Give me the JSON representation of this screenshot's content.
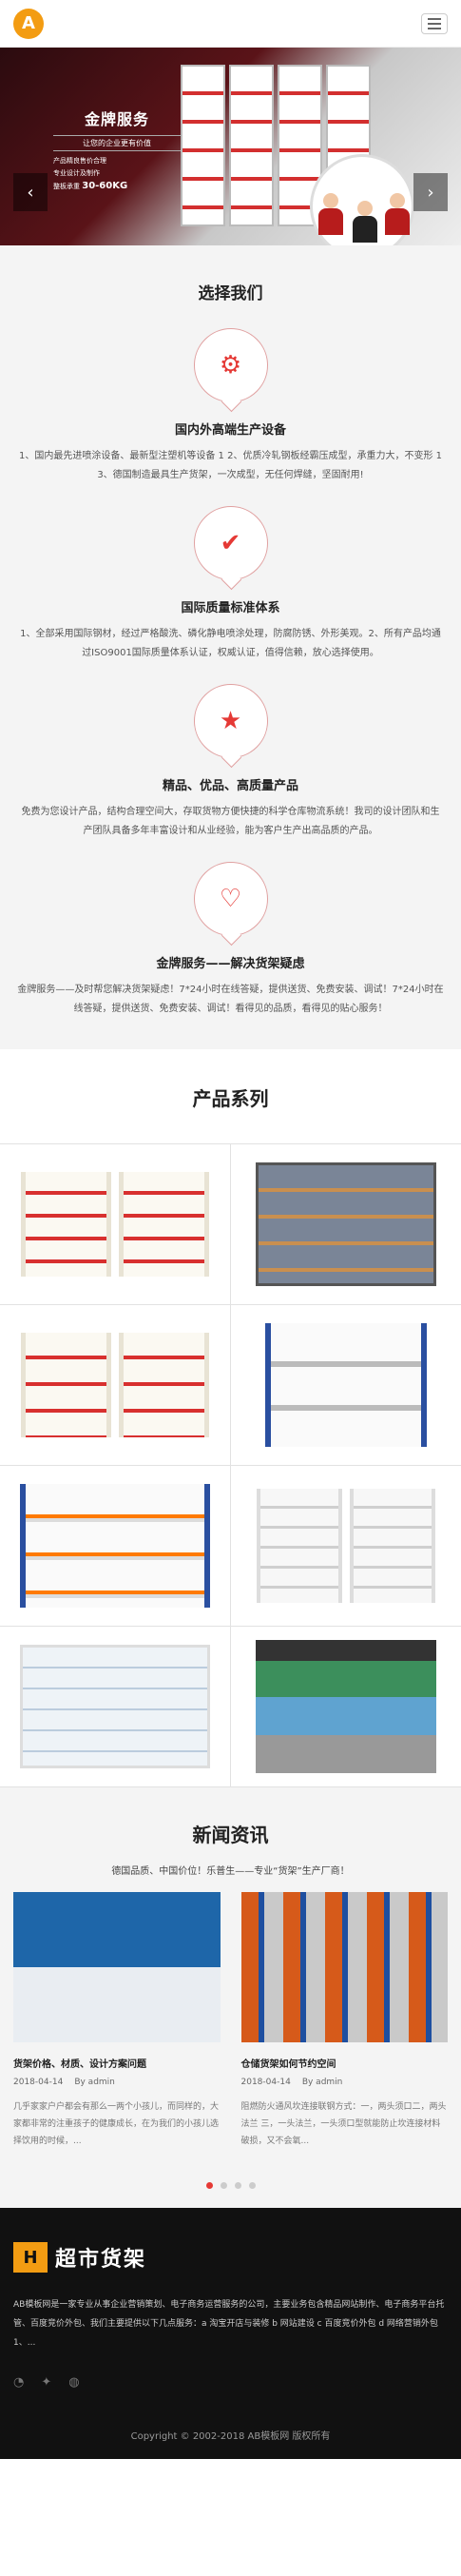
{
  "header": {
    "logo_letter": "A"
  },
  "banner": {
    "title": "金牌服务",
    "subtitle": "让您的企业更有价值",
    "bullets": [
      "产品精良售价合理",
      "专业设计及制作",
      "整板承重"
    ],
    "load_label": "30-60KG",
    "prev": "‹",
    "next": "›"
  },
  "why": {
    "title": "选择我们",
    "features": [
      {
        "icon": "⚙",
        "title": "国内外高端生产设备",
        "desc": "1、国内最先进喷涂设备、最新型注塑机等设备 1 2、优质冷轧钢板经霸压成型，承重力大，不变形 1 3、德国制造最具生产货架，一次成型，无任何焊缝，坚固耐用!"
      },
      {
        "icon": "✔",
        "title": "国际质量标准体系",
        "desc": "1、全部采用国际钢材，经过严格酸洗、磷化静电喷涂处理，防腐防锈、外形美观。2、所有产品均通过ISO9001国际质量体系认证，权威认证，值得信赖，放心选择使用。"
      },
      {
        "icon": "★",
        "title": "精品、优品、高质量产品",
        "desc": "免费为您设计产品，结构合理空间大，存取货物方便快捷的科学仓库物流系统！我司的设计团队和生产团队具备多年丰富设计和从业经验，能为客户生产出高品质的产品。"
      },
      {
        "icon": "♡",
        "title": "金牌服务——解决货架疑虑",
        "desc": "金牌服务——及时帮您解决货架疑虑！7*24小时在线答疑，提供送货、免费安装、调试！7*24小时在线答疑，提供送货、免费安装、调试！看得见的品质，看得见的贴心服务！"
      }
    ]
  },
  "products": {
    "title": "产品系列"
  },
  "news": {
    "title": "新闻资讯",
    "tagline": "德国品质、中国价位！乐普生——专业“货架”生产厂商！",
    "items": [
      {
        "title": "货架价格、材质、设计方案问题",
        "date": "2018-04-14",
        "author": "By admin",
        "desc": "几乎家家户户都会有那么一两个小孩儿，而同样的，大家都非常的注重孩子的健康成长，在为我们的小孩儿选择饮用的时候，..."
      },
      {
        "title": "仓储货架如何节约空间",
        "date": "2018-04-14",
        "author": "By admin",
        "desc": "阻燃防火通风坎连接联钢方式：一，两头须口二，两头法兰 三，一头法兰，一头须口型就能防止坎连接材料破损，又不会氧..."
      }
    ]
  },
  "footer": {
    "logo_text": "超市货架",
    "desc": "AB模板网是一家专业从事企业营销策划、电子商务运营服务的公司，主要业务包含精品网站制作、电子商务平台托管、百度竞价外包、我们主要提供以下几点服务：a 淘宝开店与装修 b 网站建设 c 百度竞价外包 d 网络营销外包 1、...",
    "copyright": "Copyright © 2002-2018 AB模板网 版权所有"
  }
}
